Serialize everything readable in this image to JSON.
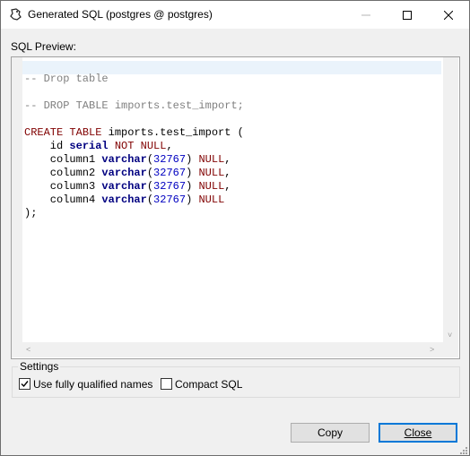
{
  "window": {
    "title": "Generated SQL (postgres @ postgres)"
  },
  "preview": {
    "label": "SQL Preview:",
    "lines": [
      "-- Drop table",
      "",
      "-- DROP TABLE imports.test_import;",
      "",
      "CREATE TABLE imports.test_import (",
      "    id serial NOT NULL,",
      "    column1 varchar(32767) NULL,",
      "    column2 varchar(32767) NULL,",
      "    column3 varchar(32767) NULL,",
      "    column4 varchar(32767) NULL",
      ");"
    ]
  },
  "settings": {
    "legend": "Settings",
    "use_fully_qualified_names": {
      "label": "Use fully qualified names",
      "checked": true
    },
    "compact_sql": {
      "label": "Compact SQL",
      "checked": false
    }
  },
  "buttons": {
    "copy": "Copy",
    "close": "Close"
  },
  "icons": {
    "app": "dbeaver-beaver-icon",
    "minimize": "minimize-icon",
    "maximize": "maximize-icon",
    "close": "close-icon"
  },
  "colors": {
    "keyword": "#800000",
    "type": "#000080",
    "number": "#0000c0",
    "comment": "#808080",
    "focus_border": "#0078d7"
  }
}
